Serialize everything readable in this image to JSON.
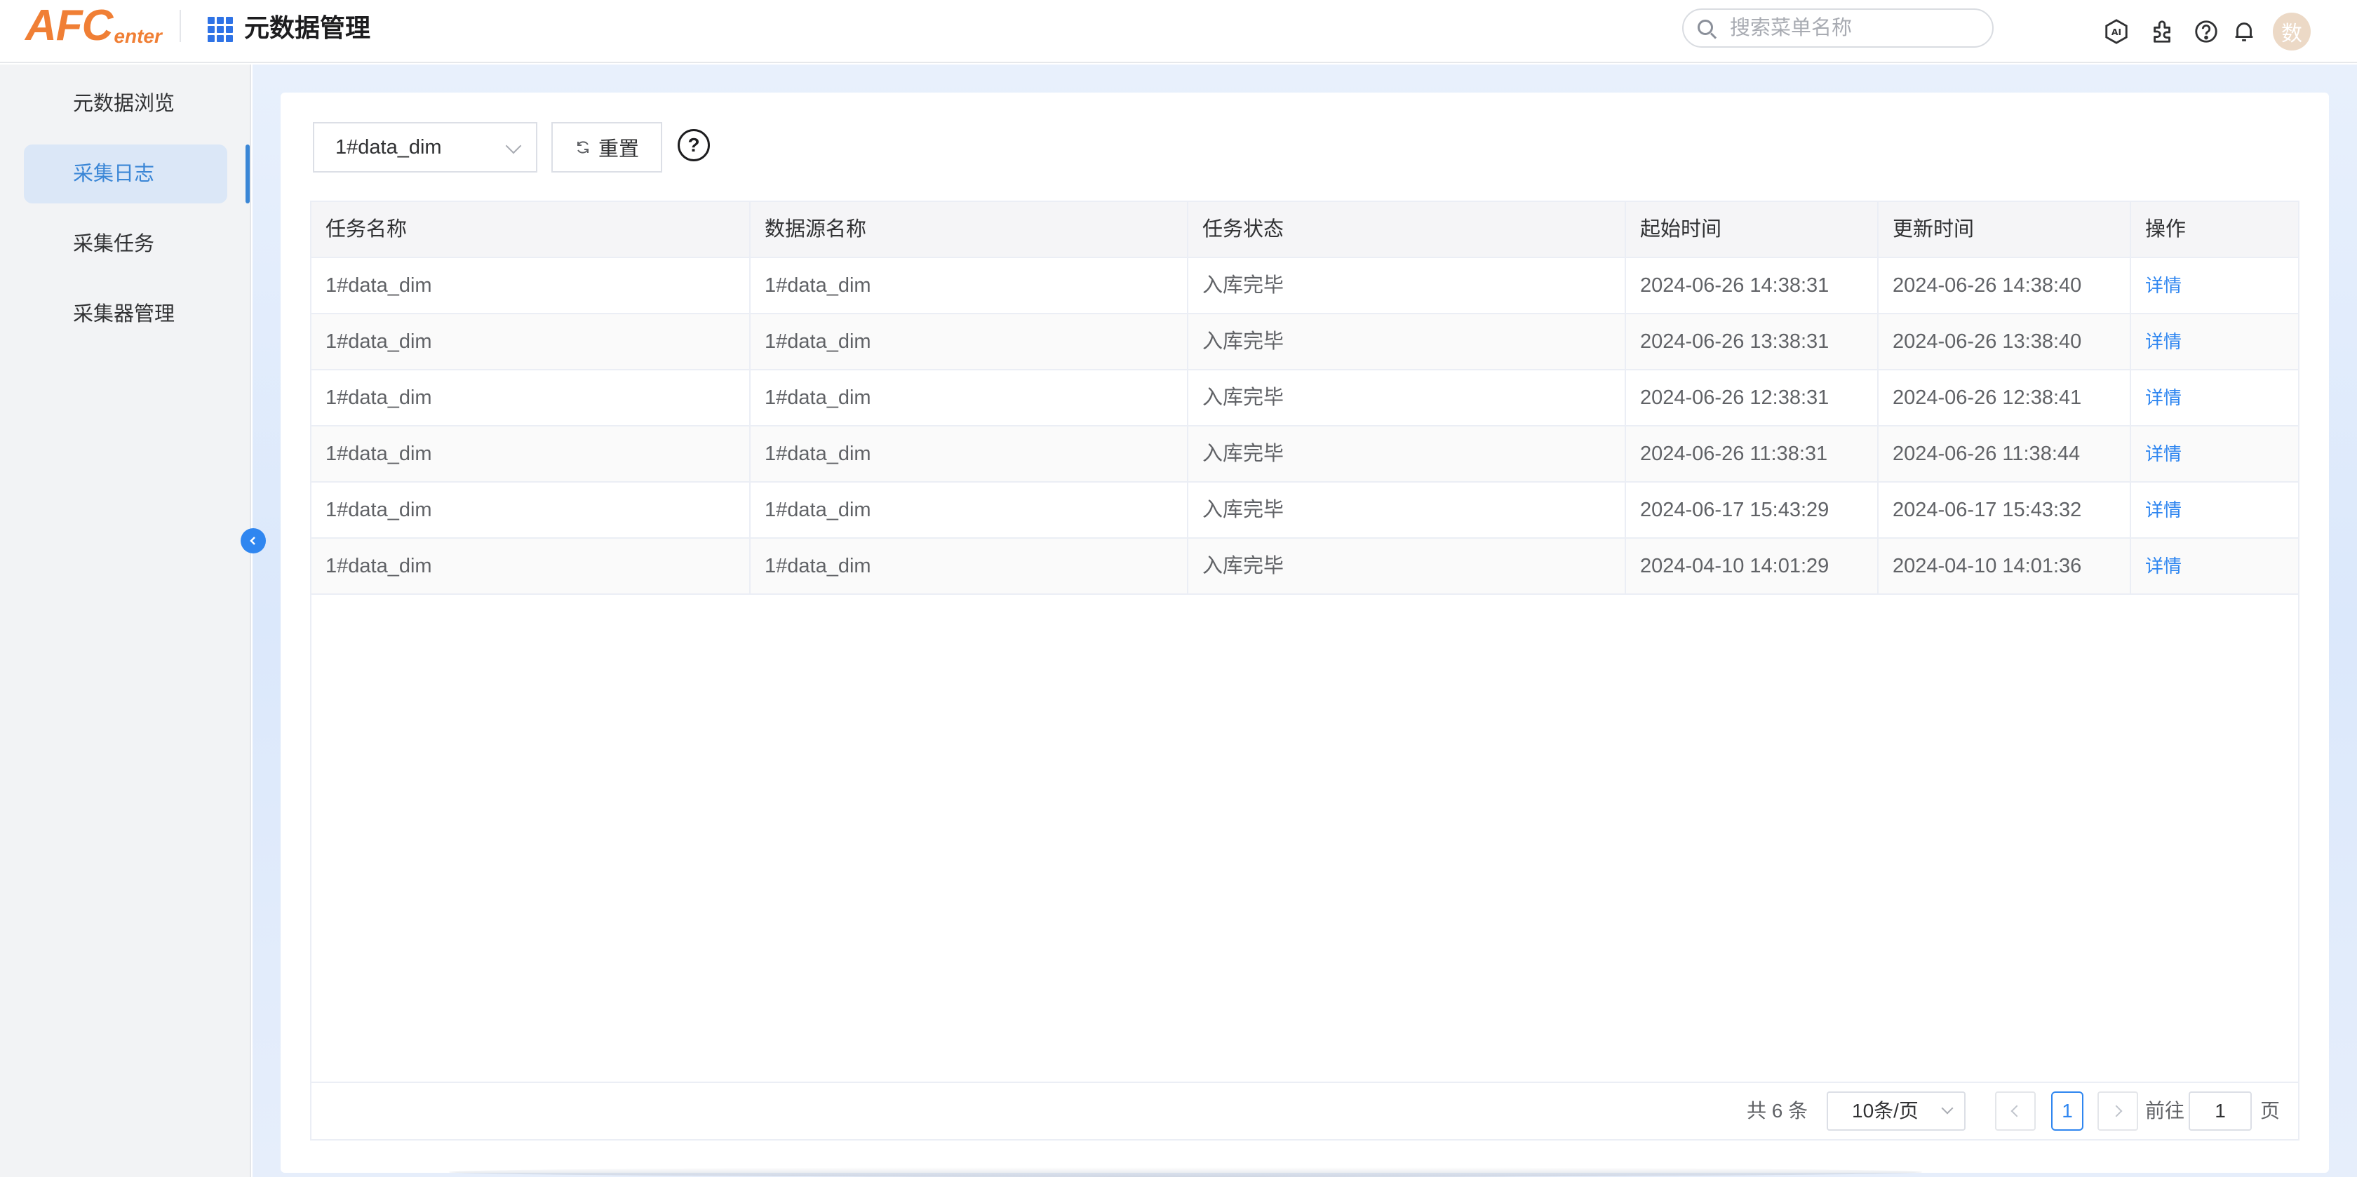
{
  "header": {
    "logo_big": "AFC",
    "logo_small": "enter",
    "app_title": "元数据管理",
    "search_placeholder": "搜索菜单名称",
    "avatar_text": "数"
  },
  "sidebar": {
    "items": [
      {
        "label": "元数据浏览"
      },
      {
        "label": "采集日志"
      },
      {
        "label": "采集任务"
      },
      {
        "label": "采集器管理"
      }
    ],
    "active_index": 1
  },
  "toolbar": {
    "select_value": "1#data_dim",
    "reset_label": "重置",
    "help_label": "?"
  },
  "table": {
    "columns": [
      "任务名称",
      "数据源名称",
      "任务状态",
      "起始时间",
      "更新时间",
      "操作"
    ],
    "rows": [
      [
        "1#data_dim",
        "1#data_dim",
        "入库完毕",
        "2024-06-26 14:38:31",
        "2024-06-26 14:38:40",
        "详情"
      ],
      [
        "1#data_dim",
        "1#data_dim",
        "入库完毕",
        "2024-06-26 13:38:31",
        "2024-06-26 13:38:40",
        "详情"
      ],
      [
        "1#data_dim",
        "1#data_dim",
        "入库完毕",
        "2024-06-26 12:38:31",
        "2024-06-26 12:38:41",
        "详情"
      ],
      [
        "1#data_dim",
        "1#data_dim",
        "入库完毕",
        "2024-06-26 11:38:31",
        "2024-06-26 11:38:44",
        "详情"
      ],
      [
        "1#data_dim",
        "1#data_dim",
        "入库完毕",
        "2024-06-17 15:43:29",
        "2024-06-17 15:43:32",
        "详情"
      ],
      [
        "1#data_dim",
        "1#data_dim",
        "入库完毕",
        "2024-04-10 14:01:29",
        "2024-04-10 14:01:36",
        "详情"
      ]
    ]
  },
  "pagination": {
    "total_text": "共 6 条",
    "page_size": "10条/页",
    "current_page": "1",
    "goto_prefix": "前往",
    "goto_value": "1",
    "goto_suffix": "页"
  },
  "colors": {
    "accent": "#2f86f0",
    "logo": "#f07f35",
    "active_bg": "#dbe7f7"
  }
}
